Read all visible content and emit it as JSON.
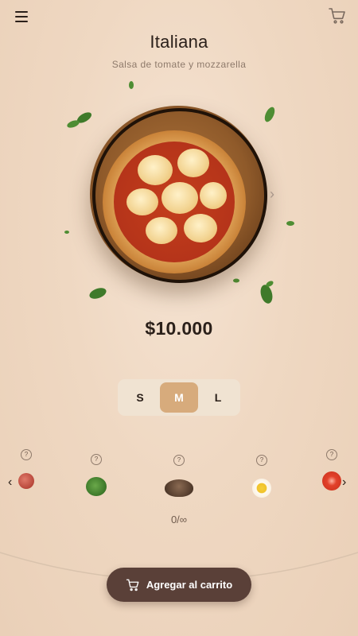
{
  "header": {
    "menu_icon": "hamburger-menu-icon",
    "cart_icon": "shopping-cart-icon"
  },
  "product": {
    "name": "Italiana",
    "description": "Salsa de tomate y mozzarella",
    "price": "$10.000",
    "image": "pizza-on-wooden-board"
  },
  "sizes": {
    "options": [
      "S",
      "M",
      "L"
    ],
    "selected": "M"
  },
  "toppings": {
    "items": [
      {
        "name": "pepperoni",
        "help": "?"
      },
      {
        "name": "spinach",
        "help": "?"
      },
      {
        "name": "ground-beef",
        "help": "?"
      },
      {
        "name": "egg",
        "help": "?"
      },
      {
        "name": "tomato",
        "help": "?"
      }
    ],
    "prev": "‹",
    "next": "›",
    "counter": "0/∞"
  },
  "carousel": {
    "next": "›"
  },
  "cta": {
    "label": "Agregar al carrito",
    "icon": "shopping-cart-icon"
  },
  "colors": {
    "accent": "#d7ab7c",
    "button": "#5a4038",
    "text": "#2b201a"
  }
}
